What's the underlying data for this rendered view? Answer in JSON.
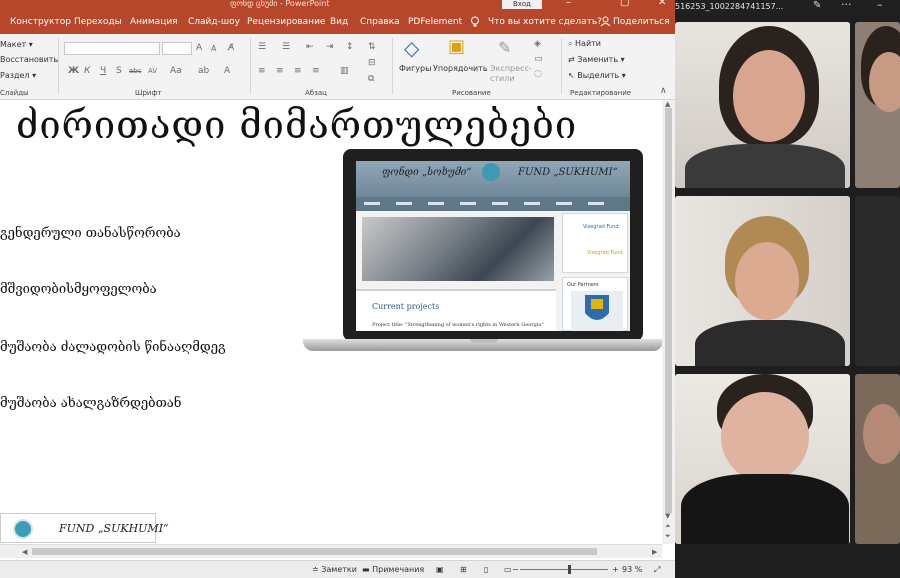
{
  "window": {
    "title": "PowerPoint",
    "title_prefix": "ფონდ ცხუმი",
    "signin": "Вход",
    "controls": [
      "–",
      "▢",
      "✕"
    ]
  },
  "ribbon_tabs": [
    "Конструктор",
    "Переходы",
    "Анимация",
    "Слайд-шоу",
    "Рецензирование",
    "Вид",
    "Справка",
    "PDFelement"
  ],
  "tell_me": "Что вы хотите сделать?",
  "share": "Поделиться",
  "ribbon": {
    "slides": {
      "layout": "Макет",
      "reset": "Восстановить",
      "section": "Раздел",
      "group": "Слайды"
    },
    "font": {
      "group": "Шрифт",
      "format": [
        "Ж",
        "К",
        "Ч",
        "S",
        "abc",
        "AV",
        "Aa"
      ]
    },
    "paragraph": {
      "group": "Абзац"
    },
    "drawing": {
      "shapes": "Фигуры",
      "arrange": "Упорядочить",
      "quick_styles": "Экспресс-стили",
      "group": "Рисование"
    },
    "editing": {
      "find": "Найти",
      "replace": "Заменить",
      "select": "Выделить",
      "group": "Редактирование"
    }
  },
  "slide": {
    "title": "ძირითადი მიმართულებები",
    "bullets": [
      "გენდერული თანასწორობა",
      "მშვიდობისმყოფელობა",
      "მუშაობა ძალადობის წინააღმდეგ",
      "მუშაობა ახალგაზრდებთან"
    ],
    "laptop_site": {
      "logo_ge": "ფონდი „სოხუმი“",
      "logo_en": "FUND „SUKHUMI“",
      "current_projects": "Current projects",
      "project_line": "Project title: \"Strengthening of women's rights in Western Georgia\"",
      "sidebar_link": "Visegrad Fund",
      "sidebar_link2": "Visegrad Fund",
      "sidebar_heading": "Our Partners"
    },
    "fund_logo_text": "FUND „SUKHUMI“"
  },
  "statusbar": {
    "notes": "Заметки",
    "comments": "Примечания",
    "zoom": "93 %"
  },
  "video": {
    "meeting_id": "516253_1002284741157...",
    "edit_icon": "✎",
    "more": "···",
    "minimize": "–"
  }
}
